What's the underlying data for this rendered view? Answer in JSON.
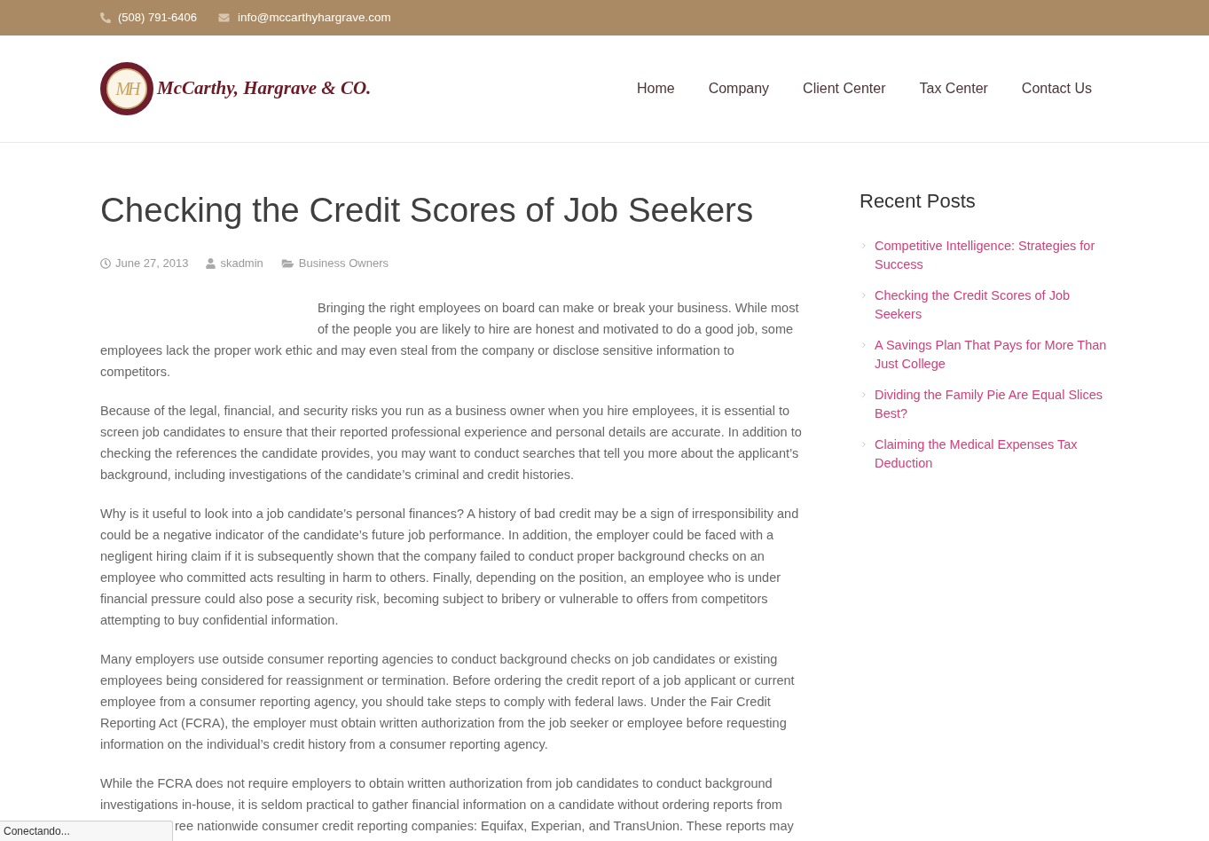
{
  "top_bar": {
    "phone": "(508) 791-6406",
    "email": "info@mccarthyhargrave.com"
  },
  "header": {
    "logo": {
      "monogram": "MH",
      "name": "McCarthy, Hargrave & CO."
    },
    "nav": [
      {
        "label": "Home"
      },
      {
        "label": "Company"
      },
      {
        "label": "Client Center"
      },
      {
        "label": "Tax Center"
      },
      {
        "label": "Contact Us"
      }
    ]
  },
  "article": {
    "title": "Checking the Credit Scores of Job Seekers",
    "meta": {
      "date": "June 27, 2013",
      "author": "skadmin",
      "category": "Business Owners"
    },
    "paragraphs": [
      {
        "text": "Bringing the right employees on board can make or break your business. While most of the people you are likely to hire are honest and motivated to do a good job, some employees lack the proper work ethic and may even steal from the company or disclose sensitive information to competitors."
      },
      {
        "text": "Because of the legal, financial, and security risks you run as a business owner when you hire employees, it is essential to screen job candidates to ensure that their reported professional experience and personal details are accurate. In addition to checking the references the candidate provides, you may want to conduct searches that tell you more about the applicant’s background, including investigations of the candidate’s criminal and credit histories."
      },
      {
        "text": "Why is it useful to look into a job candidate’s personal finances? A history of bad credit may be a sign of irresponsibility and could be a negative indicator of the candidate’s future job performance. In addition, the employer could be faced with a negligent hiring claim if it is subsequently shown that the company failed to conduct proper background checks on an employee who committed acts resulting in harm to others. Finally, depending on the position, an employee who is under financial pressure could also pose a security risk, becoming subject to bribery or vulnerable to offers from competitors attempting to buy confidential information."
      },
      {
        "text": "Many employers use outside consumer reporting agencies to conduct background checks on job candidates or existing employees being considered for reassignment or termination. Before ordering the credit report of a job applicant or current employee from a consumer reporting agency, you should take steps to comply with federal laws. Under the Fair Credit Reporting Act (FCRA), the employer must obtain written authorization from the job seeker or employee before requesting information on the individual’s credit history from a consumer reporting agency."
      },
      {
        "text": "While the FCRA does not require employers to obtain written authorization from job candidates to conduct background investigations in-house, it is seldom practical to gather financial information on a candidate without ordering reports from",
        "continuation": "ree nationwide consumer credit reporting companies: Equifax, Experian, and TransUnion. These reports may"
      }
    ]
  },
  "sidebar": {
    "heading": "Recent Posts",
    "posts": [
      {
        "title": "Competitive Intelligence: Strategies for Success"
      },
      {
        "title": "Checking the Credit Scores of Job Seekers"
      },
      {
        "title": "A Savings Plan That Pays for More Than Just College"
      },
      {
        "title": "Dividing the Family Pie Are Equal Slices Best?"
      },
      {
        "title": "Claiming the Medical Expenses Tax Deduction"
      }
    ]
  },
  "browser_status": "Conectando..."
}
